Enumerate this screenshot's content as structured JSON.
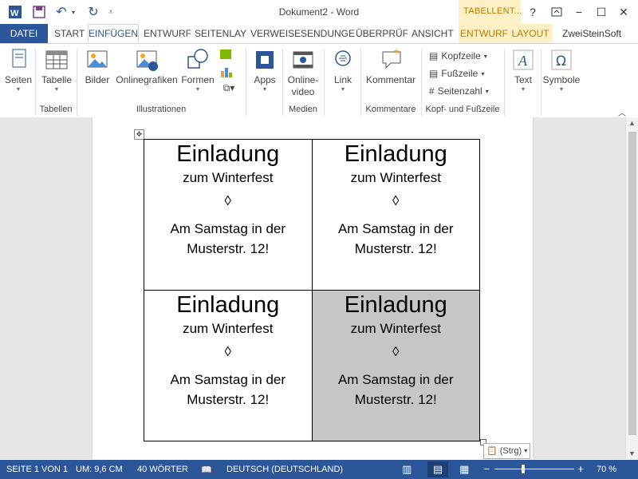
{
  "window": {
    "title": "Dokument2 - Word",
    "context_label": "TABELLENT...",
    "help": "?"
  },
  "tabs": {
    "file": "DATEI",
    "items": [
      "START",
      "EINFÜGEN",
      "ENTWURF",
      "SEITENLAY",
      "VERWEISE",
      "SENDUNGE",
      "ÜBERPRÜF",
      "ANSICHT"
    ],
    "context_tabs": [
      "ENTWURF",
      "LAYOUT"
    ],
    "user": "ZweiSteinSoft"
  },
  "ribbon": {
    "seiten": "Seiten",
    "tabelle": "Tabelle",
    "bilder": "Bilder",
    "onlinegrafiken": "Onlinegrafiken",
    "formen": "Formen",
    "apps": "Apps",
    "onlinevideo_1": "Online-",
    "onlinevideo_2": "video",
    "link": "Link",
    "kommentar": "Kommentar",
    "kopfzeile": "Kopfzeile",
    "fusszeile": "Fußzeile",
    "seitenzahl": "Seitenzahl",
    "text": "Text",
    "symbole": "Symbole",
    "groups": {
      "tabellen": "Tabellen",
      "illustrationen": "Illustrationen",
      "medien": "Medien",
      "kommentare": "Kommentare",
      "kopf": "Kopf- und Fußzeile"
    }
  },
  "cards": {
    "heading": "Einladung",
    "subheading": "zum Winterfest",
    "symbol": "◊",
    "line1": "Am Samstag in der",
    "line2": "Musterstr. 12!"
  },
  "paste_options": "(Strg)",
  "status": {
    "page": "SEITE 1 VON 1",
    "position": "UM: 9,6 CM",
    "words": "40 WÖRTER",
    "language": "DEUTSCH (DEUTSCHLAND)",
    "zoom": "70 %"
  },
  "colors": {
    "accent": "#2b579a",
    "context": "#c07b00",
    "shade": "#c6c6c6"
  }
}
